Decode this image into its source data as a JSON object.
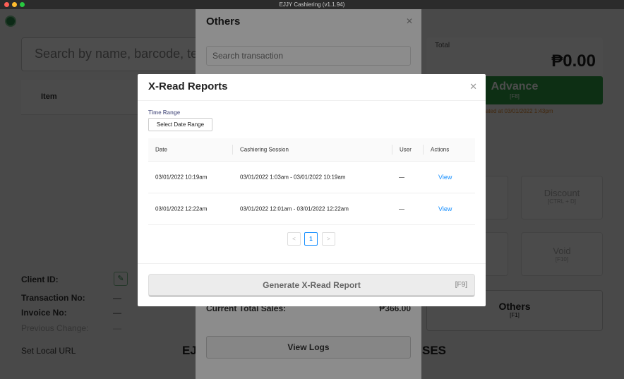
{
  "window": {
    "title": "EJJY Cashiering (v1.1.94)"
  },
  "base": {
    "search_placeholder": "Search by name, barcode, te",
    "table_header_item": "Item",
    "client_id_label": "Client ID:",
    "transaction_no_label": "Transaction No:",
    "transaction_no_value": "—",
    "invoice_no_label": "Invoice No:",
    "invoice_no_value": "—",
    "previous_change_label": "Previous Change:",
    "previous_change_value": "—",
    "set_local_url": "Set Local URL",
    "brand_left": "EJ",
    "brand_right": "SES",
    "total_label": "Total",
    "total_value": "₱0.00",
    "advance_label": "Advance",
    "advance_key": "[F8]",
    "updated_text": "updated at 03/01/2022 1:43pm",
    "discount_label": "Discount",
    "discount_key": "[CTRL + D]",
    "void_label": "Void",
    "void_key": "[F10]",
    "others_label": "Others",
    "others_key": "[F1]"
  },
  "others_drawer": {
    "title": "Others",
    "search_placeholder": "Search transaction",
    "current_sales_label": "Current Total Sales:",
    "current_sales_value": "₱366.00",
    "view_logs": "View Logs"
  },
  "xread_modal": {
    "title": "X-Read Reports",
    "time_range_label": "Time Range",
    "date_range_button": "Select Date Range",
    "columns": [
      "Date",
      "Cashiering Session",
      "User",
      "Actions"
    ],
    "rows": [
      {
        "date": "03/01/2022 10:19am",
        "session": "03/01/2022 1:03am - 03/01/2022 10:19am",
        "user": "—",
        "action": "View"
      },
      {
        "date": "03/01/2022 12:22am",
        "session": "03/01/2022 12:01am - 03/01/2022 12:22am",
        "user": "—",
        "action": "View"
      }
    ],
    "pagination": {
      "prev": "<",
      "current": "1",
      "next": ">"
    },
    "generate_label": "Generate X-Read Report",
    "generate_key": "[F9]"
  }
}
